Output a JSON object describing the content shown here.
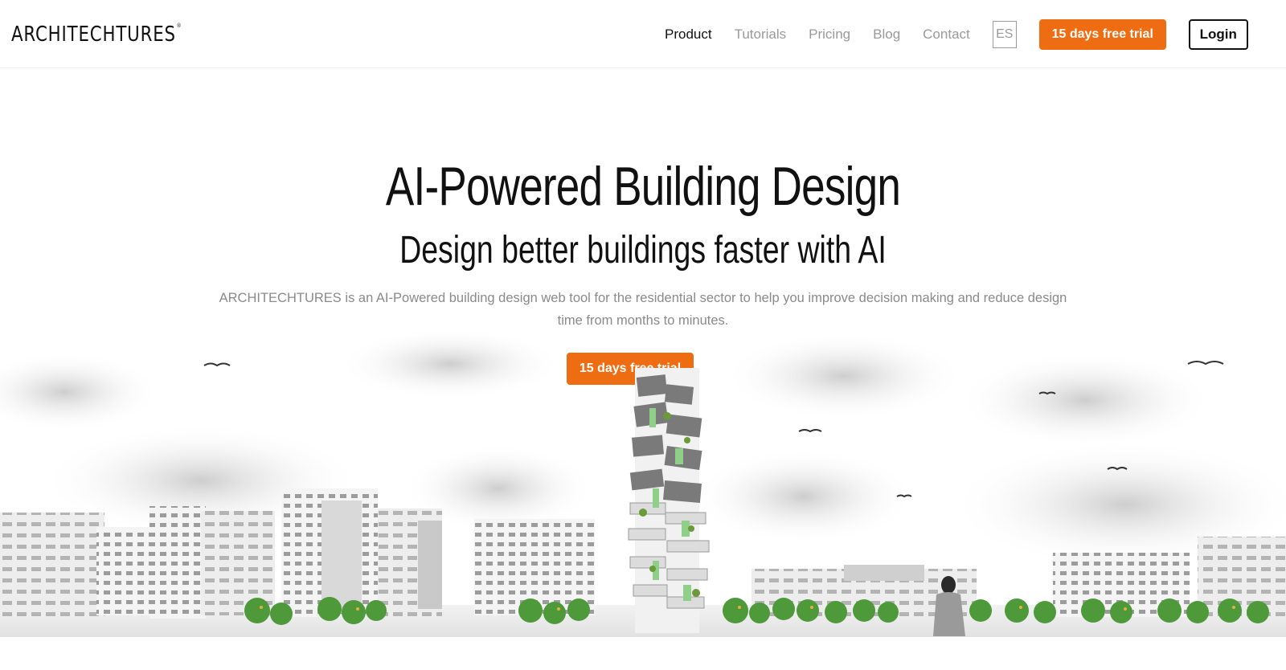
{
  "header": {
    "logo_text": "ARCHITECHTURES",
    "logo_mark": "®",
    "nav": [
      {
        "label": "Product",
        "active": true
      },
      {
        "label": "Tutorials",
        "active": false
      },
      {
        "label": "Pricing",
        "active": false
      },
      {
        "label": "Blog",
        "active": false
      },
      {
        "label": "Contact",
        "active": false
      }
    ],
    "language": "ES",
    "trial_label": "15 days free trial",
    "login_label": "Login"
  },
  "hero": {
    "title": "AI-Powered Building Design",
    "subtitle": "Design better buildings faster with AI",
    "description": "ARCHITECHTURES is an AI-Powered building design web tool for the residential sector to help you improve decision making and reduce design time from months to minutes.",
    "cta_label": "15 days free trial"
  },
  "colors": {
    "accent": "#ee6d12",
    "muted_text": "#8a8a8a",
    "tree_green": "#4e9a3a",
    "tower_green": "#8fcf8a"
  }
}
